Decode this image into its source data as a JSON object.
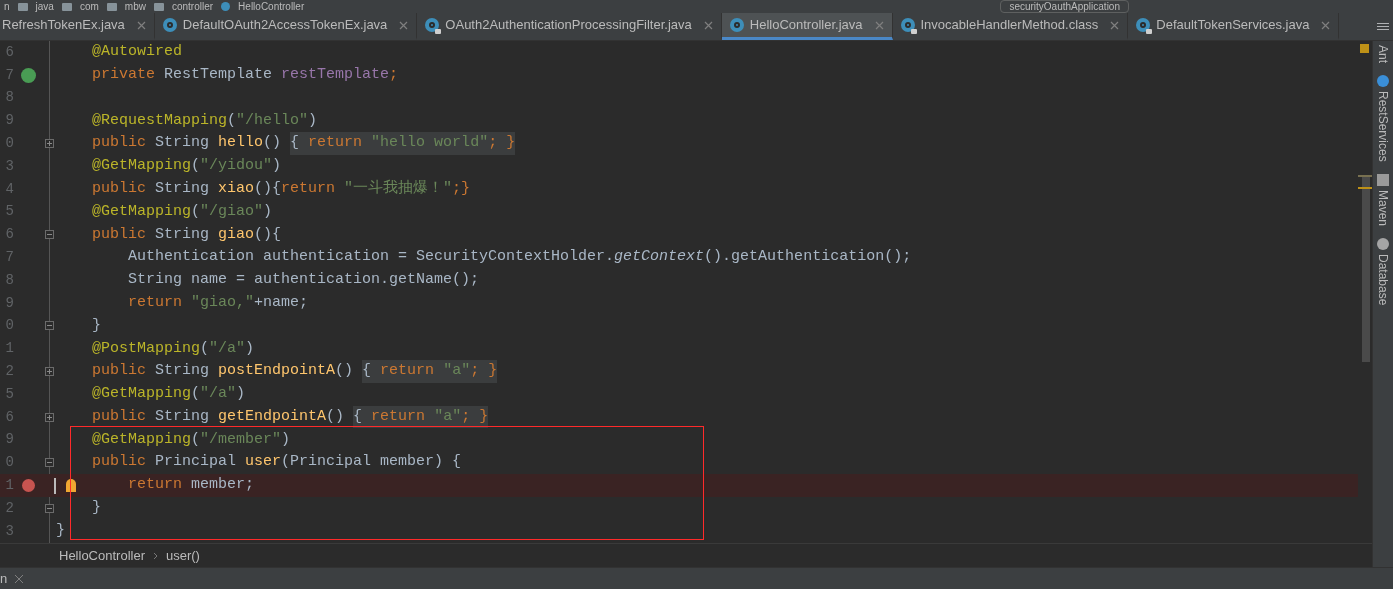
{
  "navbar": {
    "crumbs": [
      "n",
      "java",
      "com",
      "mbw",
      "controller",
      "HelloController"
    ],
    "run_config": "securityOauthApplication"
  },
  "tabs": [
    {
      "label": "RefreshTokenEx.java",
      "kind": "file",
      "selected": false
    },
    {
      "label": "DefaultOAuth2AccessTokenEx.java",
      "kind": "class",
      "read_only": false,
      "selected": false
    },
    {
      "label": "OAuth2AuthenticationProcessingFilter.java",
      "kind": "class",
      "read_only": true,
      "selected": false
    },
    {
      "label": "HelloController.java",
      "kind": "class",
      "read_only": false,
      "selected": true
    },
    {
      "label": "InvocableHandlerMethod.class",
      "kind": "class",
      "read_only": true,
      "selected": false
    },
    {
      "label": "DefaultTokenServices.java",
      "kind": "class",
      "read_only": true,
      "selected": false
    }
  ],
  "editor": {
    "lines": [
      {
        "number": "6",
        "kind": "code",
        "current": false,
        "tokens": [
          {
            "text": "    @Autowired",
            "kind": "annotation"
          }
        ]
      },
      {
        "number": "7",
        "kind": "bean",
        "current": false,
        "tokens": [
          {
            "text": "    private ",
            "kind": "keyword"
          },
          {
            "text": "RestTemplate ",
            "kind": "plain"
          },
          {
            "text": "restTemplate",
            "kind": "field"
          },
          {
            "text": ";",
            "kind": "keyword"
          }
        ]
      },
      {
        "number": "8",
        "kind": "code",
        "current": false
      },
      {
        "number": "9",
        "kind": "code",
        "current": false,
        "tokens": [
          {
            "text": "    @RequestMapping",
            "kind": "annotation"
          },
          {
            "text": "(",
            "kind": "plain"
          },
          {
            "text": "\"/hello\"",
            "kind": "string"
          },
          {
            "text": ")",
            "kind": "plain"
          }
        ]
      },
      {
        "number": "0",
        "kind": "code",
        "current": false,
        "expanded": false,
        "tokens": [
          {
            "text": "    public ",
            "kind": "keyword"
          },
          {
            "text": "String ",
            "kind": "plain"
          },
          {
            "text": "hello",
            "kind": "method"
          },
          {
            "text": "() ",
            "kind": "plain"
          }
        ],
        "folded_tokens": [
          {
            "text": "{ ",
            "kind": "plain"
          },
          {
            "text": "return ",
            "kind": "keyword"
          },
          {
            "text": "\"hello world\"",
            "kind": "string"
          },
          {
            "text": "; }",
            "kind": "keyword"
          }
        ]
      },
      {
        "number": "3",
        "kind": "code",
        "current": false,
        "tokens": [
          {
            "text": "    @GetMapping",
            "kind": "annotation"
          },
          {
            "text": "(",
            "kind": "plain"
          },
          {
            "text": "\"/yidou\"",
            "kind": "string"
          },
          {
            "text": ")",
            "kind": "plain"
          }
        ]
      },
      {
        "number": "4",
        "kind": "code",
        "current": false,
        "tokens": [
          {
            "text": "    public ",
            "kind": "keyword"
          },
          {
            "text": "String ",
            "kind": "plain"
          },
          {
            "text": "xiao",
            "kind": "method"
          },
          {
            "text": "(){",
            "kind": "plain"
          },
          {
            "text": "return ",
            "kind": "keyword"
          },
          {
            "text": "\"一斗我抽爆！\"",
            "kind": "string"
          },
          {
            "text": ";}",
            "kind": "keyword"
          }
        ]
      },
      {
        "number": "5",
        "kind": "code",
        "current": false,
        "tokens": [
          {
            "text": "    @GetMapping",
            "kind": "annotation"
          },
          {
            "text": "(",
            "kind": "plain"
          },
          {
            "text": "\"/giao\"",
            "kind": "string"
          },
          {
            "text": ")",
            "kind": "plain"
          }
        ]
      },
      {
        "number": "6",
        "kind": "code",
        "current": false,
        "expanded": true,
        "tokens": [
          {
            "text": "    public ",
            "kind": "keyword"
          },
          {
            "text": "String ",
            "kind": "plain"
          },
          {
            "text": "giao",
            "kind": "method"
          },
          {
            "text": "(){",
            "kind": "plain"
          }
        ]
      },
      {
        "number": "7",
        "kind": "code",
        "current": false,
        "tokens": [
          {
            "text": "        Authentication authentication = SecurityContextHolder.",
            "kind": "plain"
          },
          {
            "text": "getContext",
            "kind": "static"
          },
          {
            "text": "().getAuthentication();",
            "kind": "plain"
          }
        ]
      },
      {
        "number": "8",
        "kind": "code",
        "current": false,
        "tokens": [
          {
            "text": "        String name = authentication.getName();",
            "kind": "plain"
          }
        ]
      },
      {
        "number": "9",
        "kind": "code",
        "current": false,
        "tokens": [
          {
            "text": "        return ",
            "kind": "keyword"
          },
          {
            "text": "\"giao,\"",
            "kind": "string"
          },
          {
            "text": "+name;",
            "kind": "plain"
          }
        ]
      },
      {
        "number": "0",
        "kind": "code",
        "current": false,
        "expanded": true,
        "tokens": [
          {
            "text": "    }",
            "kind": "plain"
          }
        ]
      },
      {
        "number": "1",
        "kind": "code",
        "current": false,
        "tokens": [
          {
            "text": "    @PostMapping",
            "kind": "annotation"
          },
          {
            "text": "(",
            "kind": "plain"
          },
          {
            "text": "\"/a\"",
            "kind": "string"
          },
          {
            "text": ")",
            "kind": "plain"
          }
        ]
      },
      {
        "number": "2",
        "kind": "code",
        "current": false,
        "expanded": false,
        "tokens": [
          {
            "text": "    public ",
            "kind": "keyword"
          },
          {
            "text": "String ",
            "kind": "plain"
          },
          {
            "text": "postEndpointA",
            "kind": "method"
          },
          {
            "text": "() ",
            "kind": "plain"
          }
        ],
        "folded_tokens": [
          {
            "text": "{ ",
            "kind": "plain"
          },
          {
            "text": "return ",
            "kind": "keyword"
          },
          {
            "text": "\"a\"",
            "kind": "string"
          },
          {
            "text": "; }",
            "kind": "keyword"
          }
        ]
      },
      {
        "number": "5",
        "kind": "code",
        "current": false,
        "tokens": [
          {
            "text": "    @GetMapping",
            "kind": "annotation"
          },
          {
            "text": "(",
            "kind": "plain"
          },
          {
            "text": "\"/a\"",
            "kind": "string"
          },
          {
            "text": ")",
            "kind": "plain"
          }
        ]
      },
      {
        "number": "6",
        "kind": "code",
        "current": false,
        "expanded": false,
        "tokens": [
          {
            "text": "    public ",
            "kind": "keyword"
          },
          {
            "text": "String ",
            "kind": "plain"
          },
          {
            "text": "getEndpointA",
            "kind": "method"
          },
          {
            "text": "() ",
            "kind": "plain"
          }
        ],
        "folded_tokens": [
          {
            "text": "{ ",
            "kind": "plain"
          },
          {
            "text": "return ",
            "kind": "keyword"
          },
          {
            "text": "\"a\"",
            "kind": "string"
          },
          {
            "text": "; }",
            "kind": "keyword"
          }
        ]
      },
      {
        "number": "9",
        "kind": "code",
        "current": false,
        "tokens": [
          {
            "text": "    @GetMapping",
            "kind": "annotation"
          },
          {
            "text": "(",
            "kind": "plain"
          },
          {
            "text": "\"/member\"",
            "kind": "string"
          },
          {
            "text": ")",
            "kind": "plain"
          }
        ]
      },
      {
        "number": "0",
        "kind": "code",
        "current": false,
        "expanded": true,
        "tokens": [
          {
            "text": "    public ",
            "kind": "keyword"
          },
          {
            "text": "Principal ",
            "kind": "plain"
          },
          {
            "text": "user",
            "kind": "method"
          },
          {
            "text": "(Principal member) {",
            "kind": "plain"
          }
        ]
      },
      {
        "number": "1",
        "kind": "breakpoint",
        "current": true,
        "tokens": [
          {
            "text": "        return ",
            "kind": "keyword"
          },
          {
            "text": "member;",
            "kind": "plain"
          }
        ]
      },
      {
        "number": "2",
        "kind": "code",
        "current": false,
        "expanded": true,
        "tokens": [
          {
            "text": "    }",
            "kind": "plain"
          }
        ]
      },
      {
        "number": "3",
        "kind": "code",
        "current": false,
        "tokens": [
          {
            "text": "}",
            "kind": "plain"
          }
        ]
      }
    ]
  },
  "tool_windows": [
    "Ant",
    "RestServices",
    "Maven",
    "Database"
  ],
  "breadcrumb": [
    "HelloController",
    "user()"
  ],
  "bottom_tab": {
    "label": "n"
  }
}
